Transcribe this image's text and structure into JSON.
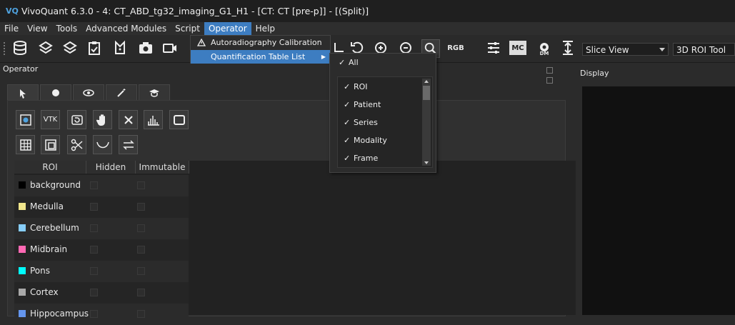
{
  "window": {
    "title": "VivoQuant 6.3.0 - 4: CT_ABD_tg32_imaging_G1_H1 - [CT: CT [pre-p]] - [(Split)]",
    "logo_text": "VQ"
  },
  "menubar": [
    "File",
    "View",
    "Tools",
    "Advanced Modules",
    "Script",
    "Operator",
    "Help"
  ],
  "operator_menu": {
    "items": [
      {
        "label": "Autoradiography Calibration",
        "icon": "warning-triangle-icon"
      },
      {
        "label": "Quantification Table List",
        "icon": "",
        "submenu_arrow": "▶"
      }
    ]
  },
  "quant_submenu": {
    "all": {
      "label": "All",
      "check": "✓"
    },
    "items": [
      {
        "label": "ROI",
        "check": "✓"
      },
      {
        "label": "Patient",
        "check": "✓"
      },
      {
        "label": "Series",
        "check": "✓"
      },
      {
        "label": "Modality",
        "check": "✓"
      },
      {
        "label": "Frame",
        "check": "✓"
      }
    ]
  },
  "toolbar": {
    "rgb_label": "RGB",
    "mc_label": "MC",
    "dm_label": "DM",
    "slice_view": "Slice View",
    "roi_tool": "3D ROI Tool"
  },
  "panels": {
    "operator_title": "Operator",
    "display_title": "Display"
  },
  "tools": {
    "vtk_label": "VTK"
  },
  "roi_table": {
    "headers": [
      "ROI",
      "Hidden",
      "Immutable"
    ],
    "rows": [
      {
        "name": "background",
        "color": "#000000"
      },
      {
        "name": "Medulla",
        "color": "#f0e68c"
      },
      {
        "name": "Cerebellum",
        "color": "#87cefa"
      },
      {
        "name": "Midbrain",
        "color": "#ff69b4"
      },
      {
        "name": "Pons",
        "color": "#00ffff"
      },
      {
        "name": "Cortex",
        "color": "#a9a9a9"
      },
      {
        "name": "Hippocampus",
        "color": "#6495ed"
      }
    ]
  },
  "colors": {
    "accent": "#3d7dc1"
  }
}
